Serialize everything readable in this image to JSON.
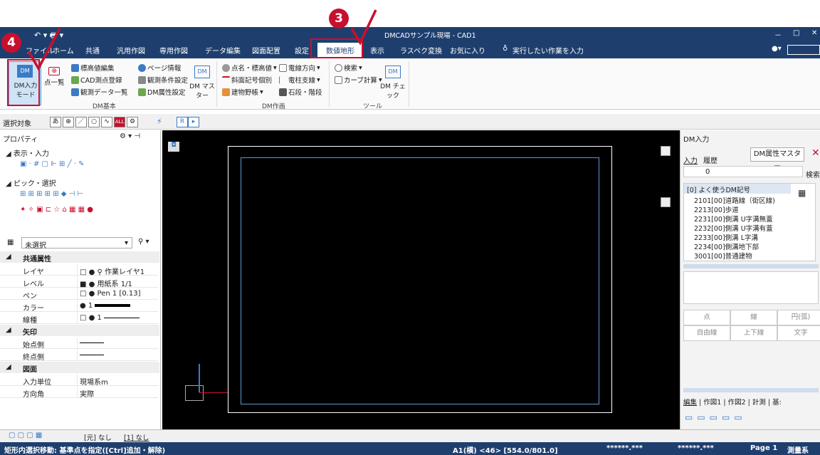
{
  "title_bar": {
    "title": "DMCADサンプル現場 - CAD1",
    "window_controls": [
      "－",
      "□",
      "✕"
    ]
  },
  "menu": {
    "tabs": [
      "ファイル",
      "ホーム",
      "共通",
      "汎用作図",
      "専用作図",
      "データ編集",
      "図面配置",
      "設定",
      "数値地形",
      "表示",
      "ラスベク変換",
      "お気に入り"
    ],
    "active_tab": "数値地形",
    "search_placeholder": "実行したい作業を入力"
  },
  "ribbon": {
    "dm_basic": {
      "dm_input_mode": "DM入力 モード",
      "point_list": "点一覧",
      "elevation_edit": "標高値編集",
      "cad_point_register": "CAD測点登録",
      "obs_data_list": "観測データ一覧",
      "page_info": "ページ情報",
      "obs_conditions": "観測条件設定",
      "dm_attr_settings": "DM属性設定",
      "dm_master": "DM マスター",
      "group_label": "DM基本"
    },
    "dm_draw": {
      "point_name_elev": "点名・標高値",
      "cable_direction": "電線方向",
      "slope_symbol": "斜面記号個別",
      "pole_support": "電柱支線",
      "building_field": "建物野帳",
      "stairs": "石段・階段",
      "group_label": "DM作画"
    },
    "tools": {
      "search": "検索",
      "curve_calc": "カーブ計算",
      "dm_check": "DM チェック",
      "group_label": "ツール"
    }
  },
  "toolbar2": {
    "label": "選択対象",
    "buttons": [
      "あ",
      "⊕",
      "／",
      "○",
      "∿",
      "ALL",
      "⚙",
      "R",
      "▸"
    ]
  },
  "left_panel": {
    "title": "プロパティ",
    "display_input": "表示・入力",
    "pick_select": "ピック・選択",
    "selection": "未選択",
    "section_common": "共通属性",
    "props": [
      {
        "k": "レイヤ",
        "v": "作業レイヤ1"
      },
      {
        "k": "レベル",
        "v": "用紙系 1/1"
      },
      {
        "k": "ペン",
        "v": "Pen 1 [0.13]"
      },
      {
        "k": "カラー",
        "v": "1"
      },
      {
        "k": "線種",
        "v": "1"
      }
    ],
    "section_arrow": "矢印",
    "arrow_props": [
      {
        "k": "始点側",
        "v": ""
      },
      {
        "k": "終点側",
        "v": ""
      }
    ],
    "section_drawing": "図面",
    "drawing_props": [
      {
        "k": "入力単位",
        "v": "現場系m"
      },
      {
        "k": "方向角",
        "v": "実際"
      }
    ]
  },
  "right_panel": {
    "title": "DM入力",
    "tabs": [
      "入力",
      "履歴"
    ],
    "master_button": "DM属性マスター",
    "search_button": "検索",
    "number_value": "0",
    "tree": [
      "[0] よく使うDM記号",
      "2101[00]道路線（街区線)",
      "2213[00]歩道",
      "2231[00]側溝 U字溝無蓋",
      "2232[00]側溝 U字溝有蓋",
      "2233[00]側溝 L字溝",
      "2234[00]側溝地下部",
      "3001[00]普通建物"
    ],
    "grid_row1": [
      "点",
      "線",
      "円(弧)"
    ],
    "grid_row2": [
      "自由線",
      "上下線",
      "文字"
    ],
    "bottom_tabs": [
      "編集",
      "作図1",
      "作図2",
      "計測",
      "基:"
    ]
  },
  "bottom_tabs": {
    "layer_none": "[元] なし",
    "layer2_none": "[1] なし"
  },
  "status_bar": {
    "message": "矩形内選択移動: 基準点を指定([Ctrl]追加・解除)",
    "sheet_info": "A1(横) <46> [554.0/801.0]",
    "coord1": "******.***",
    "coord2": "******.***",
    "page": "Page 1",
    "system": "測量系"
  },
  "annotations": {
    "badge3": "3",
    "badge4": "4"
  },
  "colors": {
    "title_bg": "#1e3f6e",
    "accent_red": "#c8102e",
    "active_tab_bg": "#ffffff"
  }
}
